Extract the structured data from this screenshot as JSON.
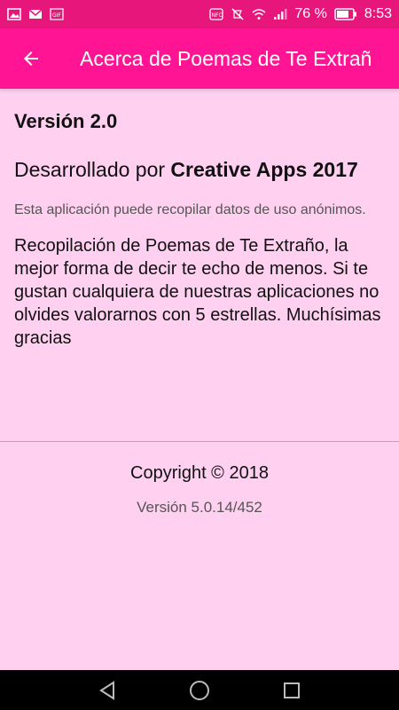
{
  "status_bar": {
    "battery_percent": "76 %",
    "time": "8:53"
  },
  "app_bar": {
    "title": "Acerca de Poemas de Te Extrañ"
  },
  "about": {
    "version_title": "Versión 2.0",
    "developer_prefix": "Desarrollado por ",
    "developer_name": "Creative Apps 2017",
    "privacy_note": "Esta aplicación puede recopilar datos de uso anónimos.",
    "description": "Recopilación de Poemas de Te Extraño, la mejor forma de decir te echo de menos. Si te gustan cualquiera de nuestras aplicaciones no olvides valorarnos con 5 estrellas. Muchísimas gracias",
    "copyright": "Copyright © 2018",
    "build_version": "Versión 5.0.14/452"
  },
  "colors": {
    "status_bar": "#e6167a",
    "app_bar": "#ff1493",
    "background": "#ffd0f0"
  },
  "icons": {
    "status_left": [
      "image-icon",
      "mail-icon",
      "gif-icon"
    ],
    "status_right": [
      "nfc-icon",
      "mute-icon",
      "wifi-icon",
      "signal-icon",
      "battery-icon"
    ],
    "nav": [
      "back-triangle-icon",
      "home-circle-icon",
      "recents-square-icon"
    ]
  }
}
